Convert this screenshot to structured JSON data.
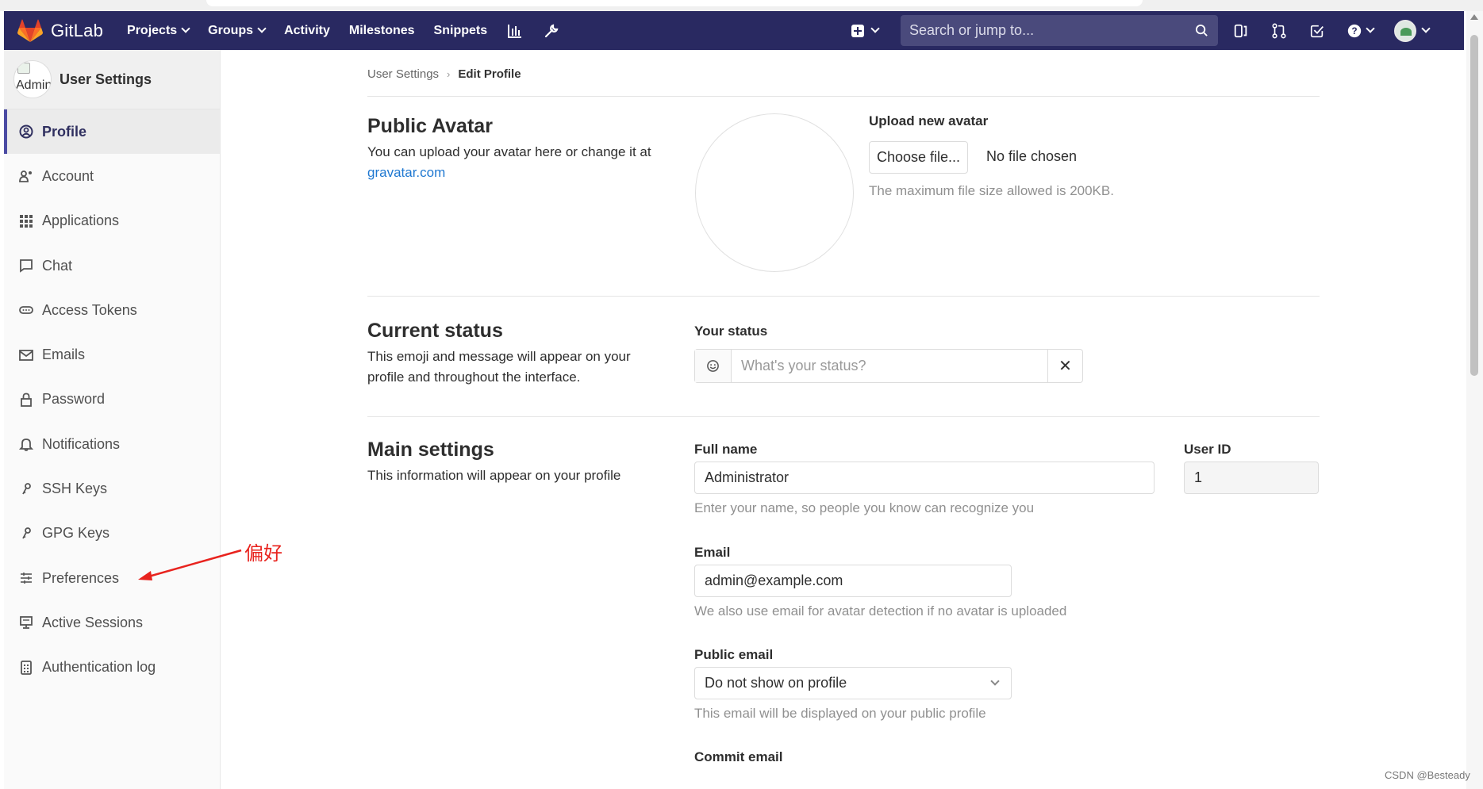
{
  "navbar": {
    "brand": "GitLab",
    "links": [
      {
        "label": "Projects",
        "dropdown": true
      },
      {
        "label": "Groups",
        "dropdown": true
      },
      {
        "label": "Activity",
        "dropdown": false
      },
      {
        "label": "Milestones",
        "dropdown": false
      },
      {
        "label": "Snippets",
        "dropdown": false
      }
    ],
    "search_placeholder": "Search or jump to...",
    "colors": {
      "bg": "#292961",
      "search_bg": "#4a4a7c",
      "logo": "#e2432a"
    }
  },
  "sidebar": {
    "title": "User Settings",
    "avatar_alt": "Admin",
    "items": [
      {
        "label": "Profile",
        "icon": "profile-icon",
        "active": true
      },
      {
        "label": "Account",
        "icon": "account-icon",
        "active": false
      },
      {
        "label": "Applications",
        "icon": "applications-icon",
        "active": false
      },
      {
        "label": "Chat",
        "icon": "chat-icon",
        "active": false
      },
      {
        "label": "Access Tokens",
        "icon": "token-icon",
        "active": false
      },
      {
        "label": "Emails",
        "icon": "mail-icon",
        "active": false
      },
      {
        "label": "Password",
        "icon": "lock-icon",
        "active": false
      },
      {
        "label": "Notifications",
        "icon": "bell-icon",
        "active": false
      },
      {
        "label": "SSH Keys",
        "icon": "key-icon",
        "active": false
      },
      {
        "label": "GPG Keys",
        "icon": "key-icon",
        "active": false
      },
      {
        "label": "Preferences",
        "icon": "sliders-icon",
        "active": false
      },
      {
        "label": "Active Sessions",
        "icon": "monitor-icon",
        "active": false
      },
      {
        "label": "Authentication log",
        "icon": "log-icon",
        "active": false
      }
    ],
    "accent": "#4b4ba3"
  },
  "breadcrumb": {
    "parent": "User Settings",
    "current": "Edit Profile"
  },
  "avatar_section": {
    "title": "Public Avatar",
    "desc": "You can upload your avatar here or change it at",
    "link": "gravatar.com",
    "upload_label": "Upload new avatar",
    "choose_button": "Choose file...",
    "no_file": "No file chosen",
    "max_size": "The maximum file size allowed is 200KB."
  },
  "status_section": {
    "title": "Current status",
    "desc": "This emoji and message will appear on your profile and throughout the interface.",
    "label": "Your status",
    "placeholder": "What's your status?",
    "clear": "✕"
  },
  "main_section": {
    "title": "Main settings",
    "desc": "This information will appear on your profile",
    "full_name_label": "Full name",
    "full_name_value": "Administrator",
    "full_name_help": "Enter your name, so people you know can recognize you",
    "user_id_label": "User ID",
    "user_id_value": "1",
    "email_label": "Email",
    "email_value": "admin@example.com",
    "email_help": "We also use email for avatar detection if no avatar is uploaded",
    "public_email_label": "Public email",
    "public_email_value": "Do not show on profile",
    "public_email_help": "This email will be displayed on your public profile",
    "commit_email_label": "Commit email"
  },
  "annotation": {
    "text": "偏好",
    "color": "#e8231e"
  },
  "watermark": "CSDN @Besteady"
}
